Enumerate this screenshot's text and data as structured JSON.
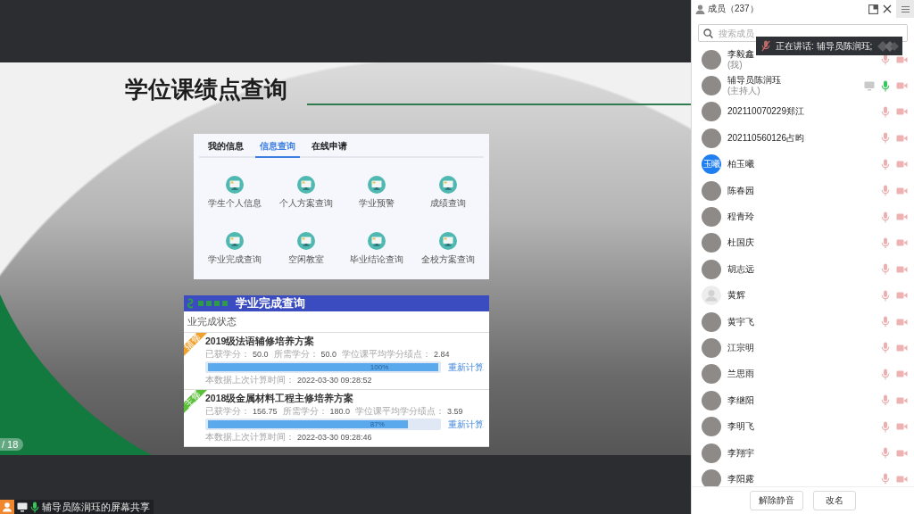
{
  "stage": {
    "slide": {
      "title": "学位课绩点查询",
      "page_counter": "/ 18",
      "info_card": {
        "tabs": [
          {
            "label": "我的信息",
            "selected": false
          },
          {
            "label": "信息查询",
            "selected": true
          },
          {
            "label": "在线申请",
            "selected": false
          }
        ],
        "items": [
          "学生个人信息",
          "个人方案查询",
          "学业预警",
          "成绩查询",
          "学业完成查询",
          "空闲教室",
          "毕业结论查询",
          "全校方案查询"
        ]
      },
      "progress_card": {
        "title": "学业完成查询",
        "section_heading": "业完成状态",
        "plans": [
          {
            "ribbon": "辅修",
            "color": "#f0a02c",
            "title": "2019级法语辅修培养方案",
            "stats": [
              {
                "label": "已获学分：",
                "value": "50.0"
              },
              {
                "label": "所需学分：",
                "value": "50.0"
              },
              {
                "label": "学位课平均学分绩点：",
                "value": "2.84"
              }
            ],
            "level": 1,
            "percent": "100%",
            "action": "重新计算",
            "time_label": "本数据上次计算时间：",
            "time": "2022-03-30 09:28:52"
          },
          {
            "ribbon": "主修",
            "color": "#5cbf3a",
            "title": "2018级金属材料工程主修培养方案",
            "stats": [
              {
                "label": "已获学分：",
                "value": "156.75"
              },
              {
                "label": "所需学分：",
                "value": "180.0"
              },
              {
                "label": "学位课平均学分绩点：",
                "value": "3.59"
              }
            ],
            "level": 0.87,
            "percent": "87%",
            "action": "重新计算",
            "time_label": "本数据上次计算时间：",
            "time": "2022-03-30 09:28:46"
          }
        ]
      }
    },
    "share_label": "辅导员陈润珏的屏幕共享"
  },
  "members_panel": {
    "title": "成员（237）",
    "search": {
      "placeholder": "搜索成员"
    },
    "speaking_notice": "正在讲话: 辅导员陈润珏;",
    "members": [
      {
        "name": "李毅鑫",
        "role": "(我)",
        "avatar": {
          "kind": "photo"
        },
        "mic_on": false,
        "camera_on": false,
        "sharing_screen": false
      },
      {
        "name": "辅导员陈润珏",
        "role": "(主持人)",
        "avatar": {
          "kind": "photo"
        },
        "mic_on": true,
        "camera_on": false,
        "sharing_screen": true
      },
      {
        "name": "202110070229郑江",
        "avatar": {
          "kind": "photo"
        },
        "mic_on": false,
        "camera_on": false,
        "sharing_screen": false
      },
      {
        "name": "202110560126占昀",
        "avatar": {
          "kind": "photo"
        },
        "mic_on": false,
        "camera_on": false,
        "sharing_screen": false
      },
      {
        "name": "柏玉曦",
        "avatar": {
          "kind": "initials",
          "text": "玉曦"
        },
        "mic_on": false,
        "camera_on": false,
        "sharing_screen": false
      },
      {
        "name": "陈春园",
        "avatar": {
          "kind": "photo"
        },
        "mic_on": false,
        "camera_on": false,
        "sharing_screen": false
      },
      {
        "name": "程青玲",
        "avatar": {
          "kind": "photo"
        },
        "mic_on": false,
        "camera_on": false,
        "sharing_screen": false
      },
      {
        "name": "杜国庆",
        "avatar": {
          "kind": "photo"
        },
        "mic_on": false,
        "camera_on": false,
        "sharing_screen": false
      },
      {
        "name": "胡志远",
        "avatar": {
          "kind": "photo"
        },
        "mic_on": false,
        "camera_on": false,
        "sharing_screen": false
      },
      {
        "name": "黄辉",
        "avatar": {
          "kind": "default"
        },
        "mic_on": false,
        "camera_on": false,
        "sharing_screen": false
      },
      {
        "name": "黄宇飞",
        "avatar": {
          "kind": "photo"
        },
        "mic_on": false,
        "camera_on": false,
        "sharing_screen": false
      },
      {
        "name": "江宗明",
        "avatar": {
          "kind": "photo"
        },
        "mic_on": false,
        "camera_on": false,
        "sharing_screen": false
      },
      {
        "name": "兰思雨",
        "avatar": {
          "kind": "photo"
        },
        "mic_on": false,
        "camera_on": false,
        "sharing_screen": false
      },
      {
        "name": "李继阳",
        "avatar": {
          "kind": "photo"
        },
        "mic_on": false,
        "camera_on": false,
        "sharing_screen": false
      },
      {
        "name": "李明飞",
        "avatar": {
          "kind": "photo"
        },
        "mic_on": false,
        "camera_on": false,
        "sharing_screen": false
      },
      {
        "name": "李翔宇",
        "avatar": {
          "kind": "photo"
        },
        "mic_on": false,
        "camera_on": false,
        "sharing_screen": false
      },
      {
        "name": "李阳露",
        "avatar": {
          "kind": "photo"
        },
        "mic_on": false,
        "camera_on": false,
        "sharing_screen": false
      }
    ],
    "buttons": [
      "解除静音",
      "改名"
    ]
  }
}
